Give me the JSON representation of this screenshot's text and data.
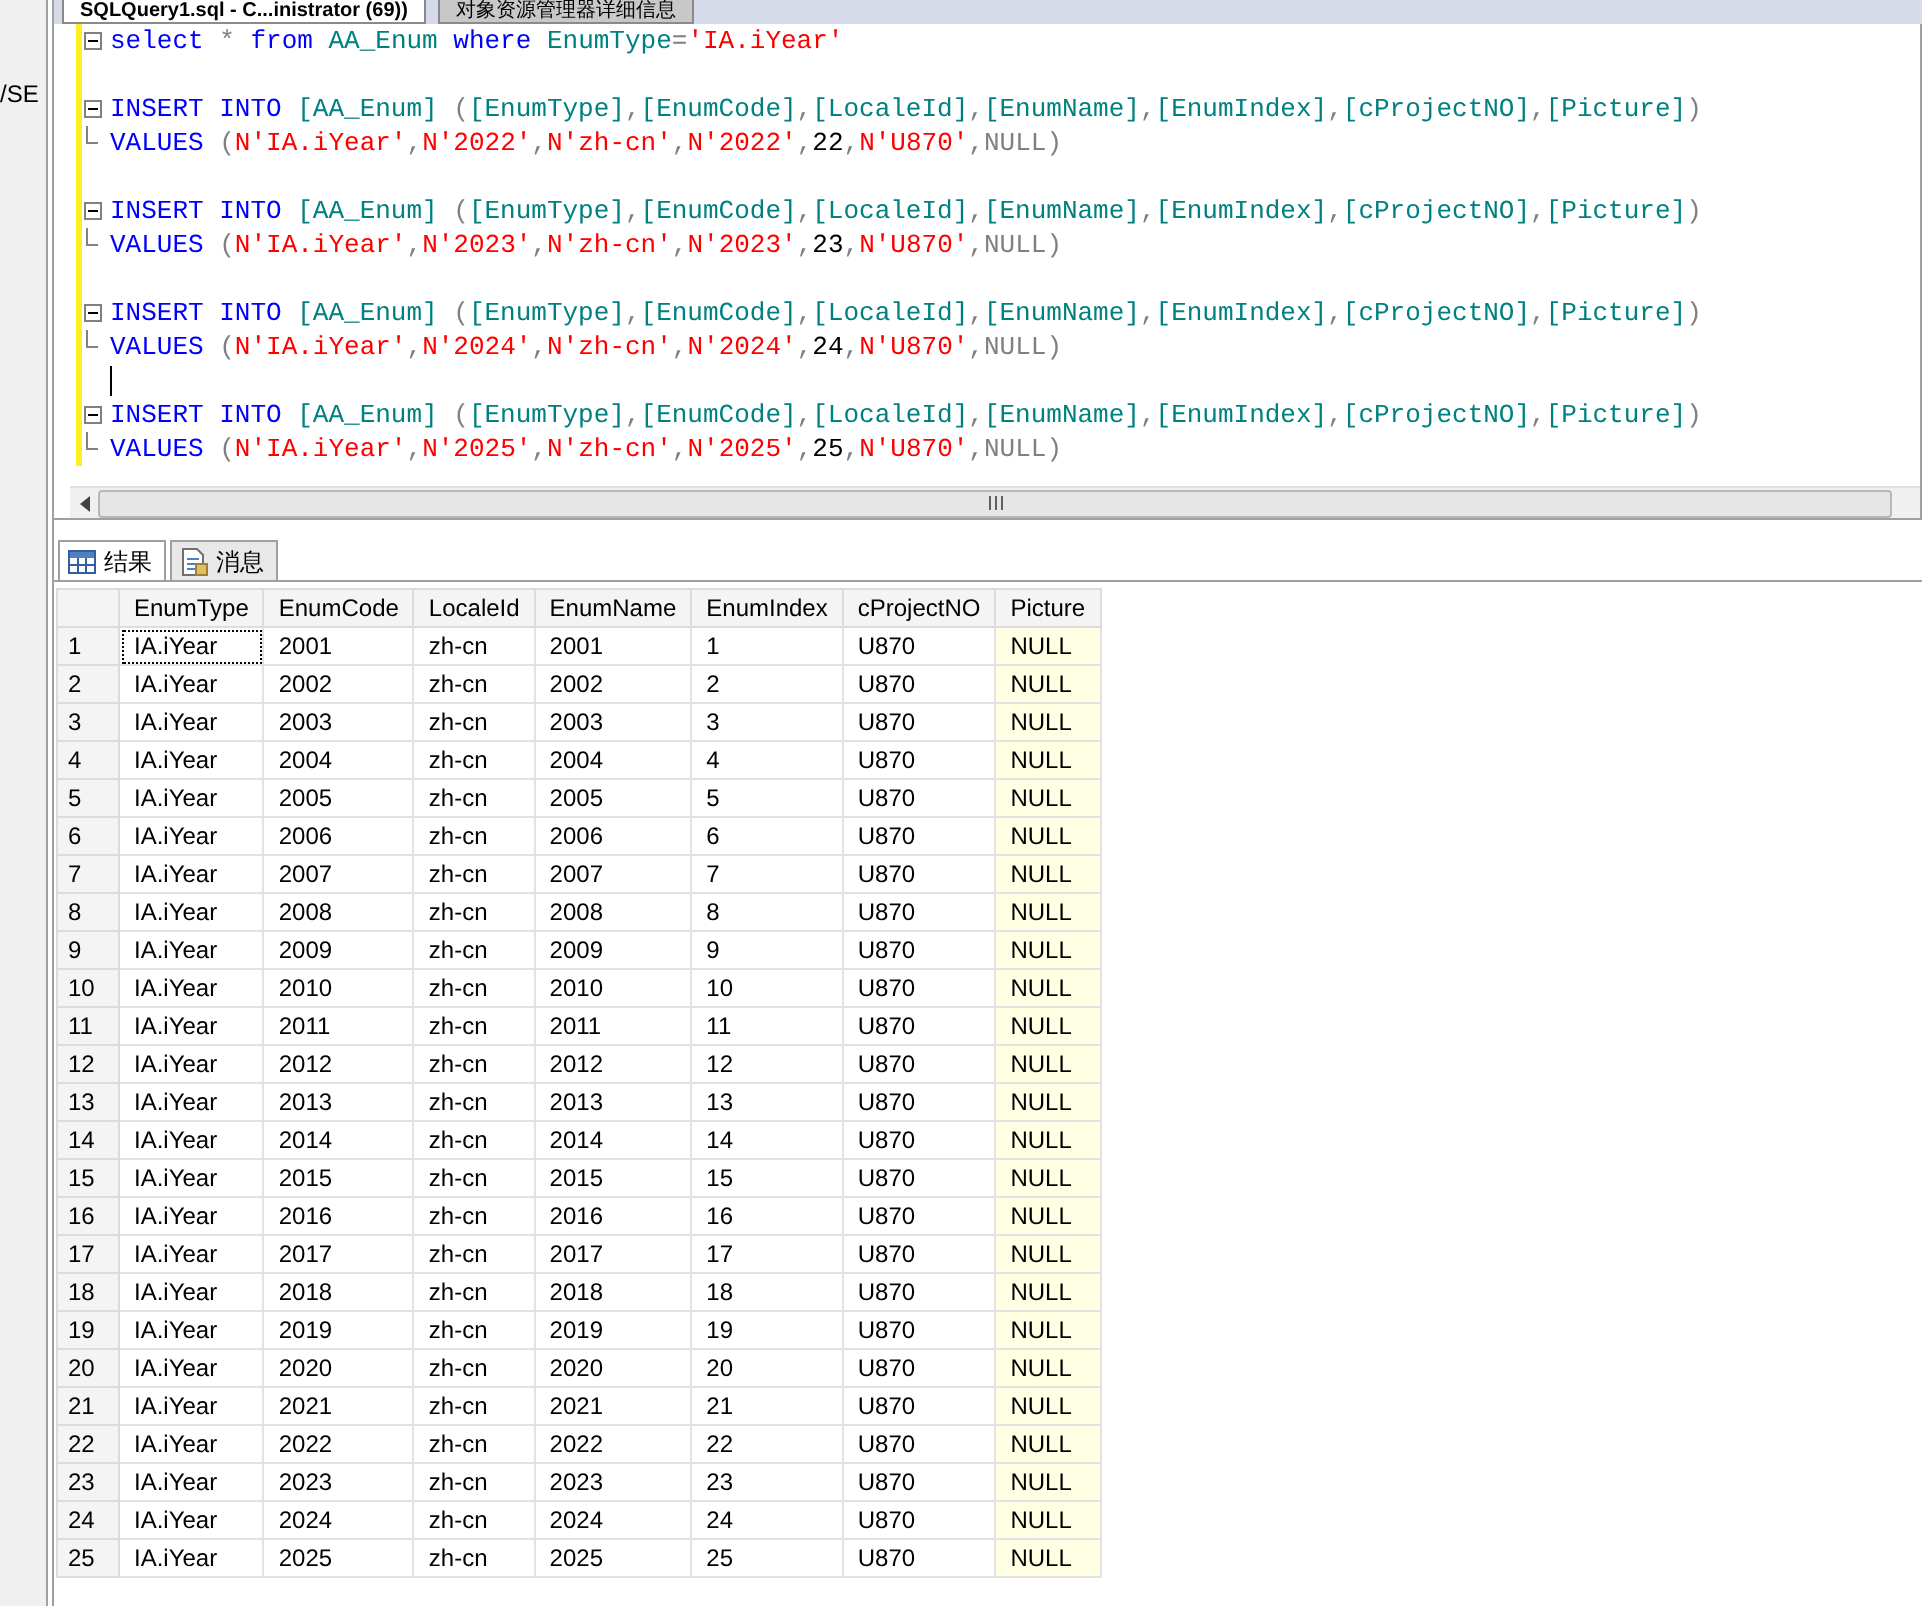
{
  "side_panel": {
    "text": "/SE"
  },
  "doc_tabs": [
    {
      "label": "SQLQuery1.sql - C...inistrator (69))",
      "selected": true
    },
    {
      "label": "对象资源管理器详细信息",
      "selected": false
    }
  ],
  "editor": {
    "lines": [
      {
        "kind": "header",
        "changed": true,
        "caret": false,
        "tokens": [
          {
            "kind": "keyword",
            "text": "select"
          },
          {
            "kind": "punct",
            "text": " * "
          },
          {
            "kind": "keyword",
            "text": "from"
          },
          {
            "kind": "object",
            "text": " AA_Enum "
          },
          {
            "kind": "keyword",
            "text": "where"
          },
          {
            "kind": "object",
            "text": " EnumType"
          },
          {
            "kind": "punct",
            "text": "="
          },
          {
            "kind": "string",
            "text": "'IA.iYear'"
          }
        ]
      },
      {
        "kind": "blank",
        "changed": true,
        "caret": false
      },
      {
        "kind": "header",
        "changed": true,
        "caret": false,
        "tokens": [
          {
            "kind": "keyword",
            "text": "INSERT INTO "
          },
          {
            "kind": "object",
            "text": "[AA_Enum]"
          },
          {
            "kind": "punct",
            "text": " ("
          },
          {
            "kind": "object",
            "text": "[EnumType]"
          },
          {
            "kind": "punct",
            "text": ","
          },
          {
            "kind": "object",
            "text": "[EnumCode]"
          },
          {
            "kind": "punct",
            "text": ","
          },
          {
            "kind": "object",
            "text": "[LocaleId]"
          },
          {
            "kind": "punct",
            "text": ","
          },
          {
            "kind": "object",
            "text": "[EnumName]"
          },
          {
            "kind": "punct",
            "text": ","
          },
          {
            "kind": "object",
            "text": "[EnumIndex]"
          },
          {
            "kind": "punct",
            "text": ","
          },
          {
            "kind": "object",
            "text": "[cProjectNO]"
          },
          {
            "kind": "punct",
            "text": ","
          },
          {
            "kind": "object",
            "text": "[Picture]"
          },
          {
            "kind": "punct",
            "text": ")"
          }
        ]
      },
      {
        "kind": "tail",
        "changed": true,
        "caret": false,
        "tokens": [
          {
            "kind": "keyword",
            "text": "VALUES "
          },
          {
            "kind": "punct",
            "text": "("
          },
          {
            "kind": "string",
            "text": "N'IA.iYear'"
          },
          {
            "kind": "punct",
            "text": ","
          },
          {
            "kind": "string",
            "text": "N'2022'"
          },
          {
            "kind": "punct",
            "text": ","
          },
          {
            "kind": "string",
            "text": "N'zh-cn'"
          },
          {
            "kind": "punct",
            "text": ","
          },
          {
            "kind": "string",
            "text": "N'2022'"
          },
          {
            "kind": "punct",
            "text": ","
          },
          {
            "kind": "plain",
            "text": "22"
          },
          {
            "kind": "punct",
            "text": ","
          },
          {
            "kind": "string",
            "text": "N'U870'"
          },
          {
            "kind": "punct",
            "text": ","
          },
          {
            "kind": "null",
            "text": "NULL"
          },
          {
            "kind": "punct",
            "text": ")"
          }
        ]
      },
      {
        "kind": "blank",
        "changed": true,
        "caret": false
      },
      {
        "kind": "header",
        "changed": true,
        "caret": false,
        "tokens": [
          {
            "kind": "keyword",
            "text": "INSERT INTO "
          },
          {
            "kind": "object",
            "text": "[AA_Enum]"
          },
          {
            "kind": "punct",
            "text": " ("
          },
          {
            "kind": "object",
            "text": "[EnumType]"
          },
          {
            "kind": "punct",
            "text": ","
          },
          {
            "kind": "object",
            "text": "[EnumCode]"
          },
          {
            "kind": "punct",
            "text": ","
          },
          {
            "kind": "object",
            "text": "[LocaleId]"
          },
          {
            "kind": "punct",
            "text": ","
          },
          {
            "kind": "object",
            "text": "[EnumName]"
          },
          {
            "kind": "punct",
            "text": ","
          },
          {
            "kind": "object",
            "text": "[EnumIndex]"
          },
          {
            "kind": "punct",
            "text": ","
          },
          {
            "kind": "object",
            "text": "[cProjectNO]"
          },
          {
            "kind": "punct",
            "text": ","
          },
          {
            "kind": "object",
            "text": "[Picture]"
          },
          {
            "kind": "punct",
            "text": ")"
          }
        ]
      },
      {
        "kind": "tail",
        "changed": true,
        "caret": false,
        "tokens": [
          {
            "kind": "keyword",
            "text": "VALUES "
          },
          {
            "kind": "punct",
            "text": "("
          },
          {
            "kind": "string",
            "text": "N'IA.iYear'"
          },
          {
            "kind": "punct",
            "text": ","
          },
          {
            "kind": "string",
            "text": "N'2023'"
          },
          {
            "kind": "punct",
            "text": ","
          },
          {
            "kind": "string",
            "text": "N'zh-cn'"
          },
          {
            "kind": "punct",
            "text": ","
          },
          {
            "kind": "string",
            "text": "N'2023'"
          },
          {
            "kind": "punct",
            "text": ","
          },
          {
            "kind": "plain",
            "text": "23"
          },
          {
            "kind": "punct",
            "text": ","
          },
          {
            "kind": "string",
            "text": "N'U870'"
          },
          {
            "kind": "punct",
            "text": ","
          },
          {
            "kind": "null",
            "text": "NULL"
          },
          {
            "kind": "punct",
            "text": ")"
          }
        ]
      },
      {
        "kind": "blank",
        "changed": true,
        "caret": false
      },
      {
        "kind": "header",
        "changed": true,
        "caret": false,
        "tokens": [
          {
            "kind": "keyword",
            "text": "INSERT INTO "
          },
          {
            "kind": "object",
            "text": "[AA_Enum]"
          },
          {
            "kind": "punct",
            "text": " ("
          },
          {
            "kind": "object",
            "text": "[EnumType]"
          },
          {
            "kind": "punct",
            "text": ","
          },
          {
            "kind": "object",
            "text": "[EnumCode]"
          },
          {
            "kind": "punct",
            "text": ","
          },
          {
            "kind": "object",
            "text": "[LocaleId]"
          },
          {
            "kind": "punct",
            "text": ","
          },
          {
            "kind": "object",
            "text": "[EnumName]"
          },
          {
            "kind": "punct",
            "text": ","
          },
          {
            "kind": "object",
            "text": "[EnumIndex]"
          },
          {
            "kind": "punct",
            "text": ","
          },
          {
            "kind": "object",
            "text": "[cProjectNO]"
          },
          {
            "kind": "punct",
            "text": ","
          },
          {
            "kind": "object",
            "text": "[Picture]"
          },
          {
            "kind": "punct",
            "text": ")"
          }
        ]
      },
      {
        "kind": "tail",
        "changed": true,
        "caret": false,
        "tokens": [
          {
            "kind": "keyword",
            "text": "VALUES "
          },
          {
            "kind": "punct",
            "text": "("
          },
          {
            "kind": "string",
            "text": "N'IA.iYear'"
          },
          {
            "kind": "punct",
            "text": ","
          },
          {
            "kind": "string",
            "text": "N'2024'"
          },
          {
            "kind": "punct",
            "text": ","
          },
          {
            "kind": "string",
            "text": "N'zh-cn'"
          },
          {
            "kind": "punct",
            "text": ","
          },
          {
            "kind": "string",
            "text": "N'2024'"
          },
          {
            "kind": "punct",
            "text": ","
          },
          {
            "kind": "plain",
            "text": "24"
          },
          {
            "kind": "punct",
            "text": ","
          },
          {
            "kind": "string",
            "text": "N'U870'"
          },
          {
            "kind": "punct",
            "text": ","
          },
          {
            "kind": "null",
            "text": "NULL"
          },
          {
            "kind": "punct",
            "text": ")"
          }
        ]
      },
      {
        "kind": "blank",
        "changed": true,
        "caret": true
      },
      {
        "kind": "header",
        "changed": true,
        "caret": false,
        "tokens": [
          {
            "kind": "keyword",
            "text": "INSERT INTO "
          },
          {
            "kind": "object",
            "text": "[AA_Enum]"
          },
          {
            "kind": "punct",
            "text": " ("
          },
          {
            "kind": "object",
            "text": "[EnumType]"
          },
          {
            "kind": "punct",
            "text": ","
          },
          {
            "kind": "object",
            "text": "[EnumCode]"
          },
          {
            "kind": "punct",
            "text": ","
          },
          {
            "kind": "object",
            "text": "[LocaleId]"
          },
          {
            "kind": "punct",
            "text": ","
          },
          {
            "kind": "object",
            "text": "[EnumName]"
          },
          {
            "kind": "punct",
            "text": ","
          },
          {
            "kind": "object",
            "text": "[EnumIndex]"
          },
          {
            "kind": "punct",
            "text": ","
          },
          {
            "kind": "object",
            "text": "[cProjectNO]"
          },
          {
            "kind": "punct",
            "text": ","
          },
          {
            "kind": "object",
            "text": "[Picture]"
          },
          {
            "kind": "punct",
            "text": ")"
          }
        ]
      },
      {
        "kind": "tail",
        "changed": true,
        "caret": false,
        "tokens": [
          {
            "kind": "keyword",
            "text": "VALUES "
          },
          {
            "kind": "punct",
            "text": "("
          },
          {
            "kind": "string",
            "text": "N'IA.iYear'"
          },
          {
            "kind": "punct",
            "text": ","
          },
          {
            "kind": "string",
            "text": "N'2025'"
          },
          {
            "kind": "punct",
            "text": ","
          },
          {
            "kind": "string",
            "text": "N'zh-cn'"
          },
          {
            "kind": "punct",
            "text": ","
          },
          {
            "kind": "string",
            "text": "N'2025'"
          },
          {
            "kind": "punct",
            "text": ","
          },
          {
            "kind": "plain",
            "text": "25"
          },
          {
            "kind": "punct",
            "text": ","
          },
          {
            "kind": "string",
            "text": "N'U870'"
          },
          {
            "kind": "punct",
            "text": ","
          },
          {
            "kind": "null",
            "text": "NULL"
          },
          {
            "kind": "punct",
            "text": ")"
          }
        ]
      }
    ]
  },
  "result_tabs": [
    {
      "label": "结果",
      "selected": true
    },
    {
      "label": "消息",
      "selected": false
    }
  ],
  "table": {
    "columns": [
      {
        "label": "EnumType",
        "kind": "text"
      },
      {
        "label": "EnumCode",
        "kind": "text"
      },
      {
        "label": "LocaleId",
        "kind": "text"
      },
      {
        "label": "EnumName",
        "kind": "text"
      },
      {
        "label": "EnumIndex",
        "kind": "text"
      },
      {
        "label": "cProjectNO",
        "kind": "text"
      },
      {
        "label": "Picture",
        "kind": "null"
      }
    ],
    "rows": [
      {
        "number": "1",
        "focused": true,
        "cells": [
          "IA.iYear",
          "2001",
          "zh-cn",
          "2001",
          "1",
          "U870",
          "NULL"
        ]
      },
      {
        "number": "2",
        "focused": false,
        "cells": [
          "IA.iYear",
          "2002",
          "zh-cn",
          "2002",
          "2",
          "U870",
          "NULL"
        ]
      },
      {
        "number": "3",
        "focused": false,
        "cells": [
          "IA.iYear",
          "2003",
          "zh-cn",
          "2003",
          "3",
          "U870",
          "NULL"
        ]
      },
      {
        "number": "4",
        "focused": false,
        "cells": [
          "IA.iYear",
          "2004",
          "zh-cn",
          "2004",
          "4",
          "U870",
          "NULL"
        ]
      },
      {
        "number": "5",
        "focused": false,
        "cells": [
          "IA.iYear",
          "2005",
          "zh-cn",
          "2005",
          "5",
          "U870",
          "NULL"
        ]
      },
      {
        "number": "6",
        "focused": false,
        "cells": [
          "IA.iYear",
          "2006",
          "zh-cn",
          "2006",
          "6",
          "U870",
          "NULL"
        ]
      },
      {
        "number": "7",
        "focused": false,
        "cells": [
          "IA.iYear",
          "2007",
          "zh-cn",
          "2007",
          "7",
          "U870",
          "NULL"
        ]
      },
      {
        "number": "8",
        "focused": false,
        "cells": [
          "IA.iYear",
          "2008",
          "zh-cn",
          "2008",
          "8",
          "U870",
          "NULL"
        ]
      },
      {
        "number": "9",
        "focused": false,
        "cells": [
          "IA.iYear",
          "2009",
          "zh-cn",
          "2009",
          "9",
          "U870",
          "NULL"
        ]
      },
      {
        "number": "10",
        "focused": false,
        "cells": [
          "IA.iYear",
          "2010",
          "zh-cn",
          "2010",
          "10",
          "U870",
          "NULL"
        ]
      },
      {
        "number": "11",
        "focused": false,
        "cells": [
          "IA.iYear",
          "2011",
          "zh-cn",
          "2011",
          "11",
          "U870",
          "NULL"
        ]
      },
      {
        "number": "12",
        "focused": false,
        "cells": [
          "IA.iYear",
          "2012",
          "zh-cn",
          "2012",
          "12",
          "U870",
          "NULL"
        ]
      },
      {
        "number": "13",
        "focused": false,
        "cells": [
          "IA.iYear",
          "2013",
          "zh-cn",
          "2013",
          "13",
          "U870",
          "NULL"
        ]
      },
      {
        "number": "14",
        "focused": false,
        "cells": [
          "IA.iYear",
          "2014",
          "zh-cn",
          "2014",
          "14",
          "U870",
          "NULL"
        ]
      },
      {
        "number": "15",
        "focused": false,
        "cells": [
          "IA.iYear",
          "2015",
          "zh-cn",
          "2015",
          "15",
          "U870",
          "NULL"
        ]
      },
      {
        "number": "16",
        "focused": false,
        "cells": [
          "IA.iYear",
          "2016",
          "zh-cn",
          "2016",
          "16",
          "U870",
          "NULL"
        ]
      },
      {
        "number": "17",
        "focused": false,
        "cells": [
          "IA.iYear",
          "2017",
          "zh-cn",
          "2017",
          "17",
          "U870",
          "NULL"
        ]
      },
      {
        "number": "18",
        "focused": false,
        "cells": [
          "IA.iYear",
          "2018",
          "zh-cn",
          "2018",
          "18",
          "U870",
          "NULL"
        ]
      },
      {
        "number": "19",
        "focused": false,
        "cells": [
          "IA.iYear",
          "2019",
          "zh-cn",
          "2019",
          "19",
          "U870",
          "NULL"
        ]
      },
      {
        "number": "20",
        "focused": false,
        "cells": [
          "IA.iYear",
          "2020",
          "zh-cn",
          "2020",
          "20",
          "U870",
          "NULL"
        ]
      },
      {
        "number": "21",
        "focused": false,
        "cells": [
          "IA.iYear",
          "2021",
          "zh-cn",
          "2021",
          "21",
          "U870",
          "NULL"
        ]
      },
      {
        "number": "22",
        "focused": false,
        "cells": [
          "IA.iYear",
          "2022",
          "zh-cn",
          "2022",
          "22",
          "U870",
          "NULL"
        ]
      },
      {
        "number": "23",
        "focused": false,
        "cells": [
          "IA.iYear",
          "2023",
          "zh-cn",
          "2023",
          "23",
          "U870",
          "NULL"
        ]
      },
      {
        "number": "24",
        "focused": false,
        "cells": [
          "IA.iYear",
          "2024",
          "zh-cn",
          "2024",
          "24",
          "U870",
          "NULL"
        ]
      },
      {
        "number": "25",
        "focused": false,
        "cells": [
          "IA.iYear",
          "2025",
          "zh-cn",
          "2025",
          "25",
          "U870",
          "NULL"
        ]
      }
    ]
  }
}
